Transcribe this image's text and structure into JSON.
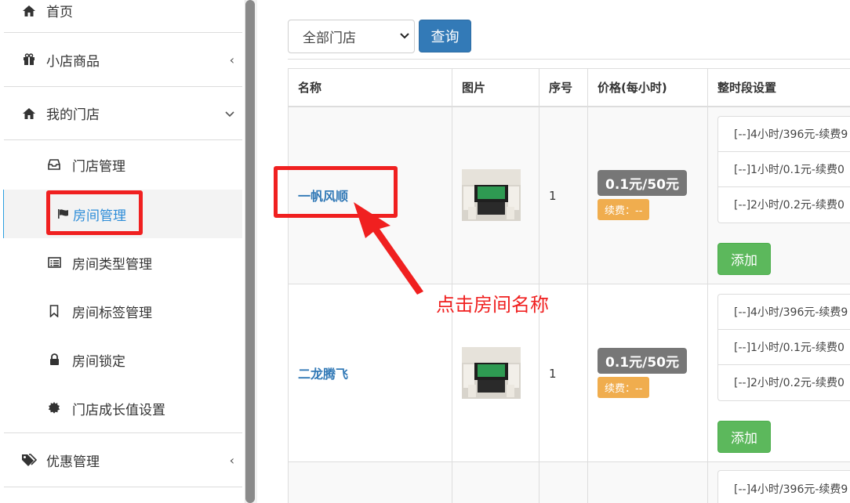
{
  "sidebar": {
    "items": [
      {
        "label": "首页",
        "icon": "home-icon"
      },
      {
        "label": "小店商品",
        "icon": "gift-icon",
        "chevron": "‹"
      },
      {
        "label": "我的门店",
        "icon": "home-icon",
        "chevron": "⌄"
      },
      {
        "label": "优惠管理",
        "icon": "tags-icon",
        "chevron": "‹"
      }
    ],
    "sub_items": [
      {
        "label": "门店管理",
        "icon": "inbox-icon"
      },
      {
        "label": "房间管理",
        "icon": "flag-icon",
        "active": true
      },
      {
        "label": "房间类型管理",
        "icon": "list-alt-icon"
      },
      {
        "label": "房间标签管理",
        "icon": "bookmark-icon"
      },
      {
        "label": "房间锁定",
        "icon": "lock-icon"
      },
      {
        "label": "门店成长值设置",
        "icon": "certificate-icon"
      }
    ]
  },
  "filter": {
    "store_select_value": "全部门店",
    "query_label": "查询"
  },
  "table": {
    "headers": [
      "名称",
      "图片",
      "序号",
      "价格(每小时)",
      "整时段设置"
    ],
    "rows": [
      {
        "name": "一帆风顺",
        "seq": "1",
        "price": "0.1元/50元",
        "renew": "续费：--",
        "slots": [
          "[--]4小时/396元-续费9",
          "[--]1小时/0.1元-续费0",
          "[--]2小时/0.2元-续费0"
        ],
        "add_label": "添加"
      },
      {
        "name": "二龙腾飞",
        "seq": "1",
        "price": "0.1元/50元",
        "renew": "续费：--",
        "slots": [
          "[--]4小时/396元-续费9",
          "[--]1小时/0.1元-续费0",
          "[--]2小时/0.2元-续费0"
        ],
        "add_label": "添加"
      },
      {
        "slots": [
          "[--]4小时/396元-续费9"
        ]
      }
    ]
  },
  "annotation": {
    "text": "点击房间名称",
    "color": "#f02020"
  },
  "colors": {
    "primary": "#337ab7",
    "success": "#5cb85c",
    "warning": "#f0ad4e",
    "active_bar": "#2b9fe0"
  }
}
